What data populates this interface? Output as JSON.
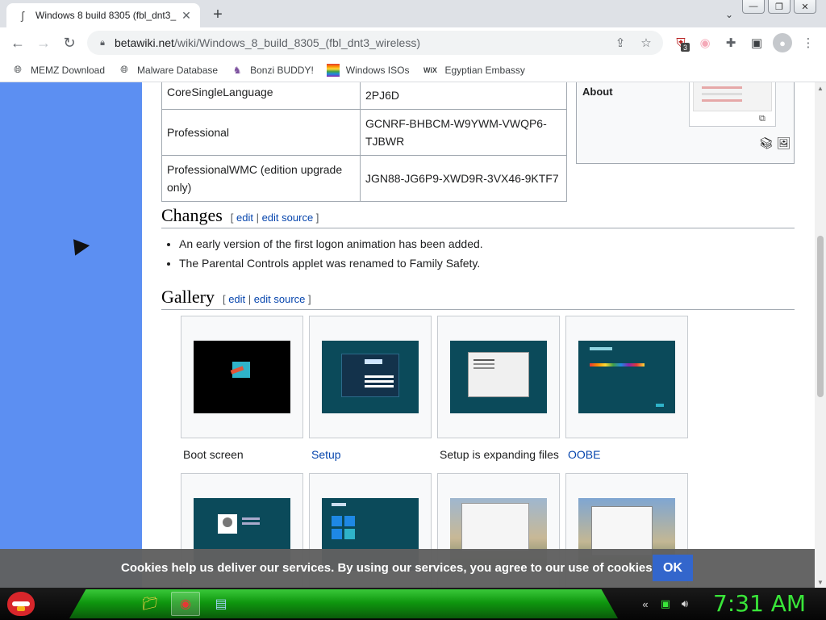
{
  "browser": {
    "tab_title": "Windows 8 build 8305 (fbl_dnt3_",
    "url_host": "betawiki.net",
    "url_path": "/wiki/Windows_8_build_8305_(fbl_dnt3_wireless)",
    "extension_badge": "3",
    "bookmarks": [
      {
        "label": "MEMZ Download",
        "icon": "globe-icon"
      },
      {
        "label": "Malware Database",
        "icon": "globe-icon"
      },
      {
        "label": "Bonzi BUDDY!",
        "icon": "bonzi-icon"
      },
      {
        "label": "Windows ISOs",
        "icon": "windows-flag-icon"
      },
      {
        "label": "Egyptian Embassy",
        "icon": "wix-icon"
      }
    ]
  },
  "article": {
    "keys": [
      {
        "edition": "CoreSingleLanguage",
        "key": "2PJ6D"
      },
      {
        "edition": "Professional",
        "key": "GCNRF-BHBCM-W9YWM-VWQP6-TJBWR"
      },
      {
        "edition": "ProfessionalWMC (edition upgrade only)",
        "key": "JGN88-JG6P9-XWD9R-3VX46-9KTF7"
      }
    ],
    "infobox_about": "About",
    "changes_heading": "Changes",
    "gallery_heading": "Gallery",
    "edit_link": "edit",
    "edit_source_link": "edit source",
    "changes": [
      "An early version of the first logon animation has been added.",
      "The Parental Controls applet was renamed to Family Safety."
    ],
    "gallery": [
      {
        "caption": "Boot screen",
        "link": false
      },
      {
        "caption": "Setup",
        "link": true
      },
      {
        "caption": "Setup is expanding files",
        "link": false
      },
      {
        "caption": "OOBE",
        "link": true
      }
    ]
  },
  "cookie": {
    "text": "Cookies help us deliver our services. By using our services, you agree to our use of cookies.",
    "ok_label": "OK"
  },
  "taskbar": {
    "clock": "7:31 AM"
  },
  "colors": {
    "link": "#0645ad",
    "left_band": "#5c8ff2",
    "cookie_ok": "#3366cc",
    "clock": "#39e639"
  }
}
